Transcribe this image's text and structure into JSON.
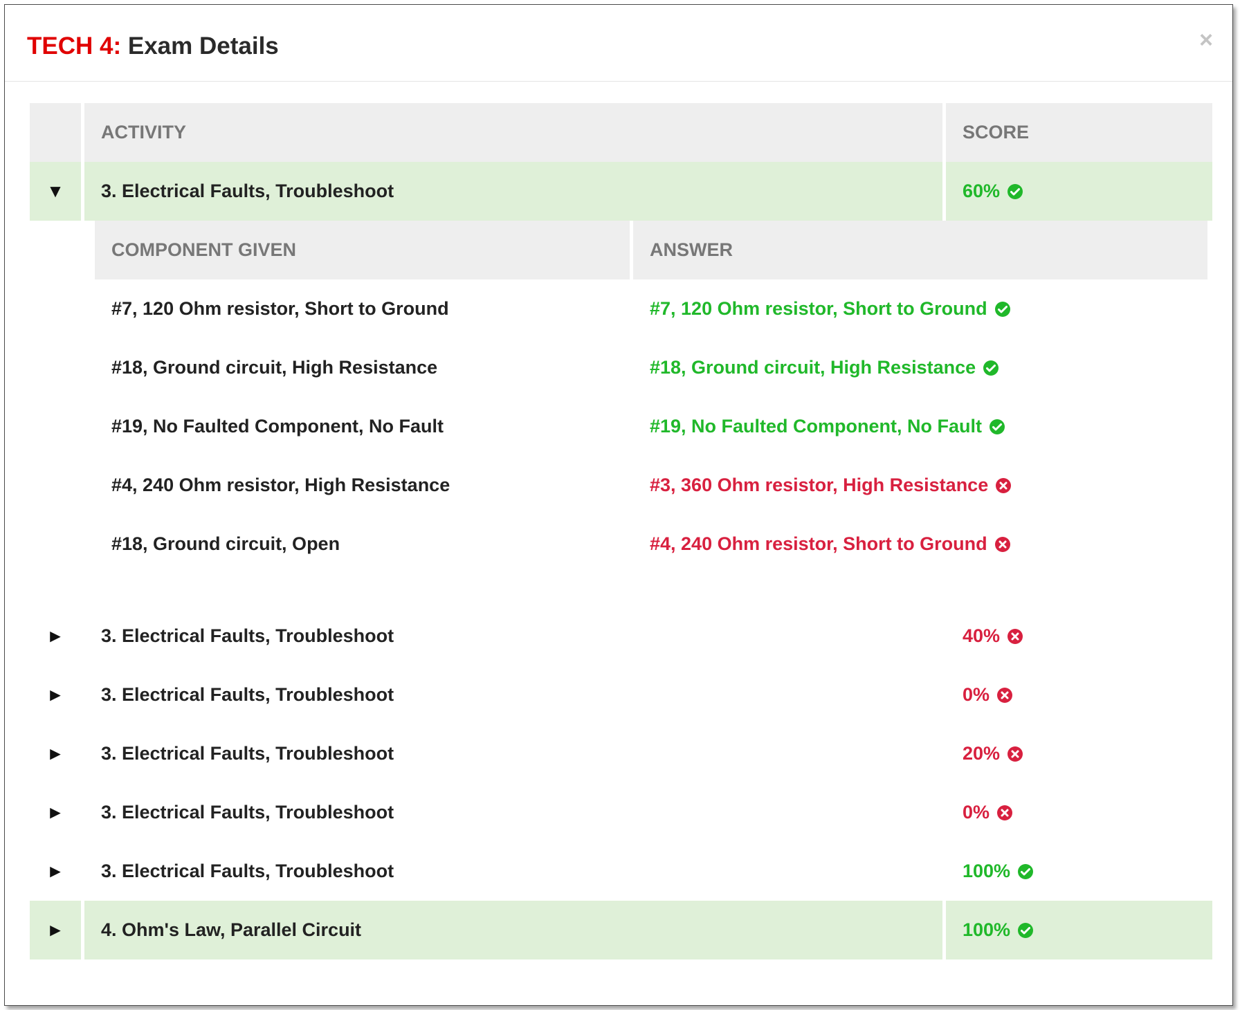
{
  "modal": {
    "title_prefix": "TECH 4:",
    "title": "Exam Details",
    "close_label": "×"
  },
  "table": {
    "col_activity": "ACTIVITY",
    "col_score": "SCORE",
    "caret_expanded": "▼",
    "caret_collapsed": "►",
    "expanded_row": {
      "activity": "3. Electrical Faults, Troubleshoot",
      "score": "60%",
      "status": "pass",
      "subtable": {
        "col_component": "COMPONENT GIVEN",
        "col_answer": "ANSWER",
        "rows": [
          {
            "given": "#7, 120 Ohm resistor, Short to Ground",
            "answer": "#7, 120 Ohm resistor, Short to Ground",
            "status": "pass"
          },
          {
            "given": "#18, Ground circuit, High Resistance",
            "answer": "#18, Ground circuit, High Resistance",
            "status": "pass"
          },
          {
            "given": "#19, No Faulted Component, No Fault",
            "answer": "#19, No Faulted Component, No Fault",
            "status": "pass"
          },
          {
            "given": "#4, 240 Ohm resistor, High Resistance",
            "answer": "#3, 360 Ohm resistor, High Resistance",
            "status": "fail"
          },
          {
            "given": "#18, Ground circuit, Open",
            "answer": "#4, 240 Ohm resistor, Short to Ground",
            "status": "fail"
          }
        ]
      }
    },
    "collapsed_rows": [
      {
        "activity": "3. Electrical Faults, Troubleshoot",
        "score": "40%",
        "status": "fail"
      },
      {
        "activity": "3. Electrical Faults, Troubleshoot",
        "score": "0%",
        "status": "fail"
      },
      {
        "activity": "3. Electrical Faults, Troubleshoot",
        "score": "20%",
        "status": "fail"
      },
      {
        "activity": "3. Electrical Faults, Troubleshoot",
        "score": "0%",
        "status": "fail"
      },
      {
        "activity": "3. Electrical Faults, Troubleshoot",
        "score": "100%",
        "status": "pass"
      },
      {
        "activity": "4. Ohm's Law, Parallel Circuit",
        "score": "100%",
        "status": "pass",
        "highlight": true
      }
    ]
  },
  "colors": {
    "pass": "#20b82a",
    "fail": "#d8203f",
    "highlight": "#dff0d8",
    "header": "#eeeeee",
    "title_prefix": "#e00000"
  },
  "icons": {
    "pass": "check-circle-icon",
    "fail": "times-circle-icon"
  }
}
